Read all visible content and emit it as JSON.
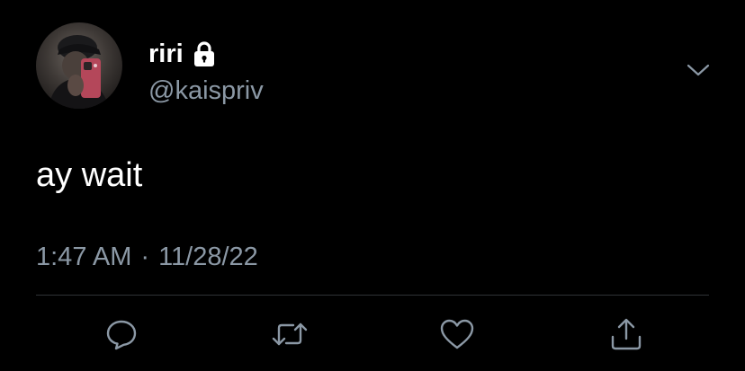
{
  "tweet": {
    "display_name": "riri",
    "handle": "@kaispriv",
    "protected_icon": "lock-icon",
    "text": "ay wait",
    "time": "1:47 AM",
    "separator": "·",
    "date": "11/28/22"
  },
  "actions": {
    "reply_icon": "reply-icon",
    "retweet_icon": "retweet-icon",
    "like_icon": "heart-icon",
    "share_icon": "share-icon"
  },
  "menu": {
    "icon": "chevron-down-icon"
  },
  "colors": {
    "background": "#000000",
    "text_primary": "#ffffff",
    "text_secondary": "#8b98a5",
    "divider": "#2f3336"
  }
}
